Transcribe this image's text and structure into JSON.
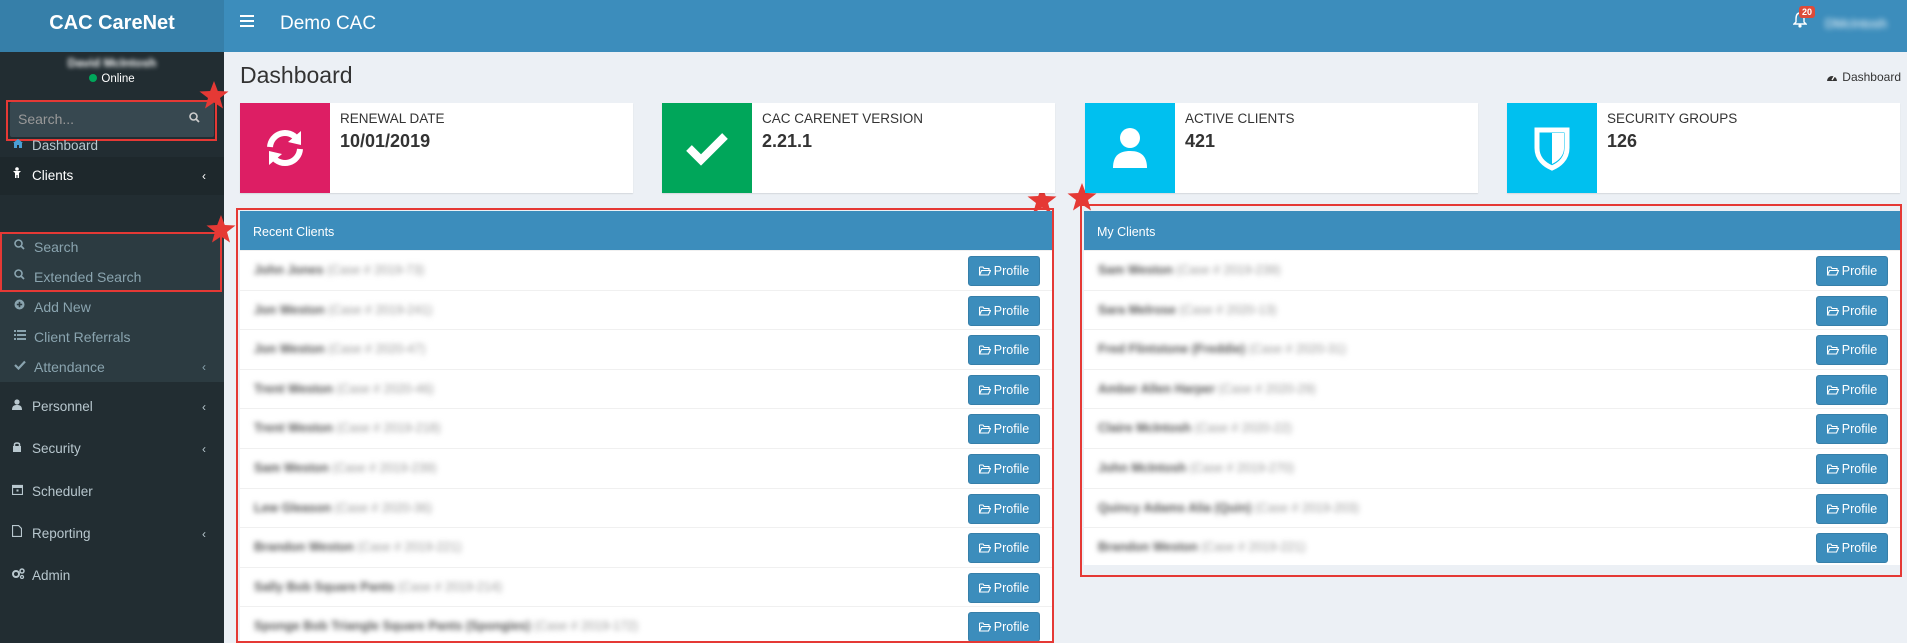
{
  "header": {
    "logo": "CAC CareNet",
    "app_title": "Demo CAC",
    "notifications_count": "20",
    "user_name": "DMcIntosh"
  },
  "sidebar": {
    "user": {
      "name": "David McIntosh",
      "status": "Online"
    },
    "search_placeholder": "Search...",
    "items": {
      "dashboard": "Dashboard",
      "clients": "Clients",
      "search": "Search",
      "extended_search": "Extended Search",
      "add_new": "Add New",
      "client_referrals": "Client Referrals",
      "attendance": "Attendance",
      "personnel": "Personnel",
      "security": "Security",
      "scheduler": "Scheduler",
      "reporting": "Reporting",
      "admin": "Admin"
    }
  },
  "page": {
    "title": "Dashboard",
    "breadcrumb": "Dashboard"
  },
  "info_boxes": [
    {
      "label": "RENEWAL DATE",
      "value": "10/01/2019",
      "color": "#dd1e64",
      "icon": "refresh-icon"
    },
    {
      "label": "CAC CARENET VERSION",
      "value": "2.21.1",
      "color": "#00a65a",
      "icon": "check-icon"
    },
    {
      "label": "ACTIVE CLIENTS",
      "value": "421",
      "color": "#00c0ef",
      "icon": "user-icon"
    },
    {
      "label": "SECURITY GROUPS",
      "value": "126",
      "color": "#00c0ef",
      "icon": "shield-icon"
    }
  ],
  "recent_clients": {
    "title": "Recent Clients",
    "button_label": "Profile",
    "rows": [
      {
        "name": "John Jones",
        "case": "(Case # 2019-73)"
      },
      {
        "name": "Jon Weston",
        "case": "(Case # 2019-241)"
      },
      {
        "name": "Jon Weston",
        "case": "(Case # 2020-47)"
      },
      {
        "name": "Trent Weston",
        "case": "(Case # 2020-46)"
      },
      {
        "name": "Trent Weston",
        "case": "(Case # 2019-218)"
      },
      {
        "name": "Sam Weston",
        "case": "(Case # 2019-239)"
      },
      {
        "name": "Lew Gleason",
        "case": "(Case # 2020-36)"
      },
      {
        "name": "Brandon Weston",
        "case": "(Case # 2019-221)"
      },
      {
        "name": "Sally Bob Square Pants",
        "case": "(Case # 2019-214)"
      },
      {
        "name": "Sponge Bob Triangle Square Pants (Spongies)",
        "case": "(Case # 2019-172)"
      }
    ]
  },
  "my_clients": {
    "title": "My Clients",
    "button_label": "Profile",
    "rows": [
      {
        "name": "Sam Weston",
        "case": "(Case # 2019-239)"
      },
      {
        "name": "Sara Melrose",
        "case": "(Case # 2020-13)"
      },
      {
        "name": "Fred Flintstone (Freddie)",
        "case": "(Case # 2020-31)"
      },
      {
        "name": "Amber Allen Harper",
        "case": "(Case # 2020-29)"
      },
      {
        "name": "Claire McIntosh",
        "case": "(Case # 2020-22)"
      },
      {
        "name": "John McIntosh",
        "case": "(Case # 2019-270)"
      },
      {
        "name": "Quincy Adams Alia (Quin)",
        "case": "(Case # 2019-203)"
      },
      {
        "name": "Brandon Weston",
        "case": "(Case # 2019-221)"
      }
    ]
  }
}
